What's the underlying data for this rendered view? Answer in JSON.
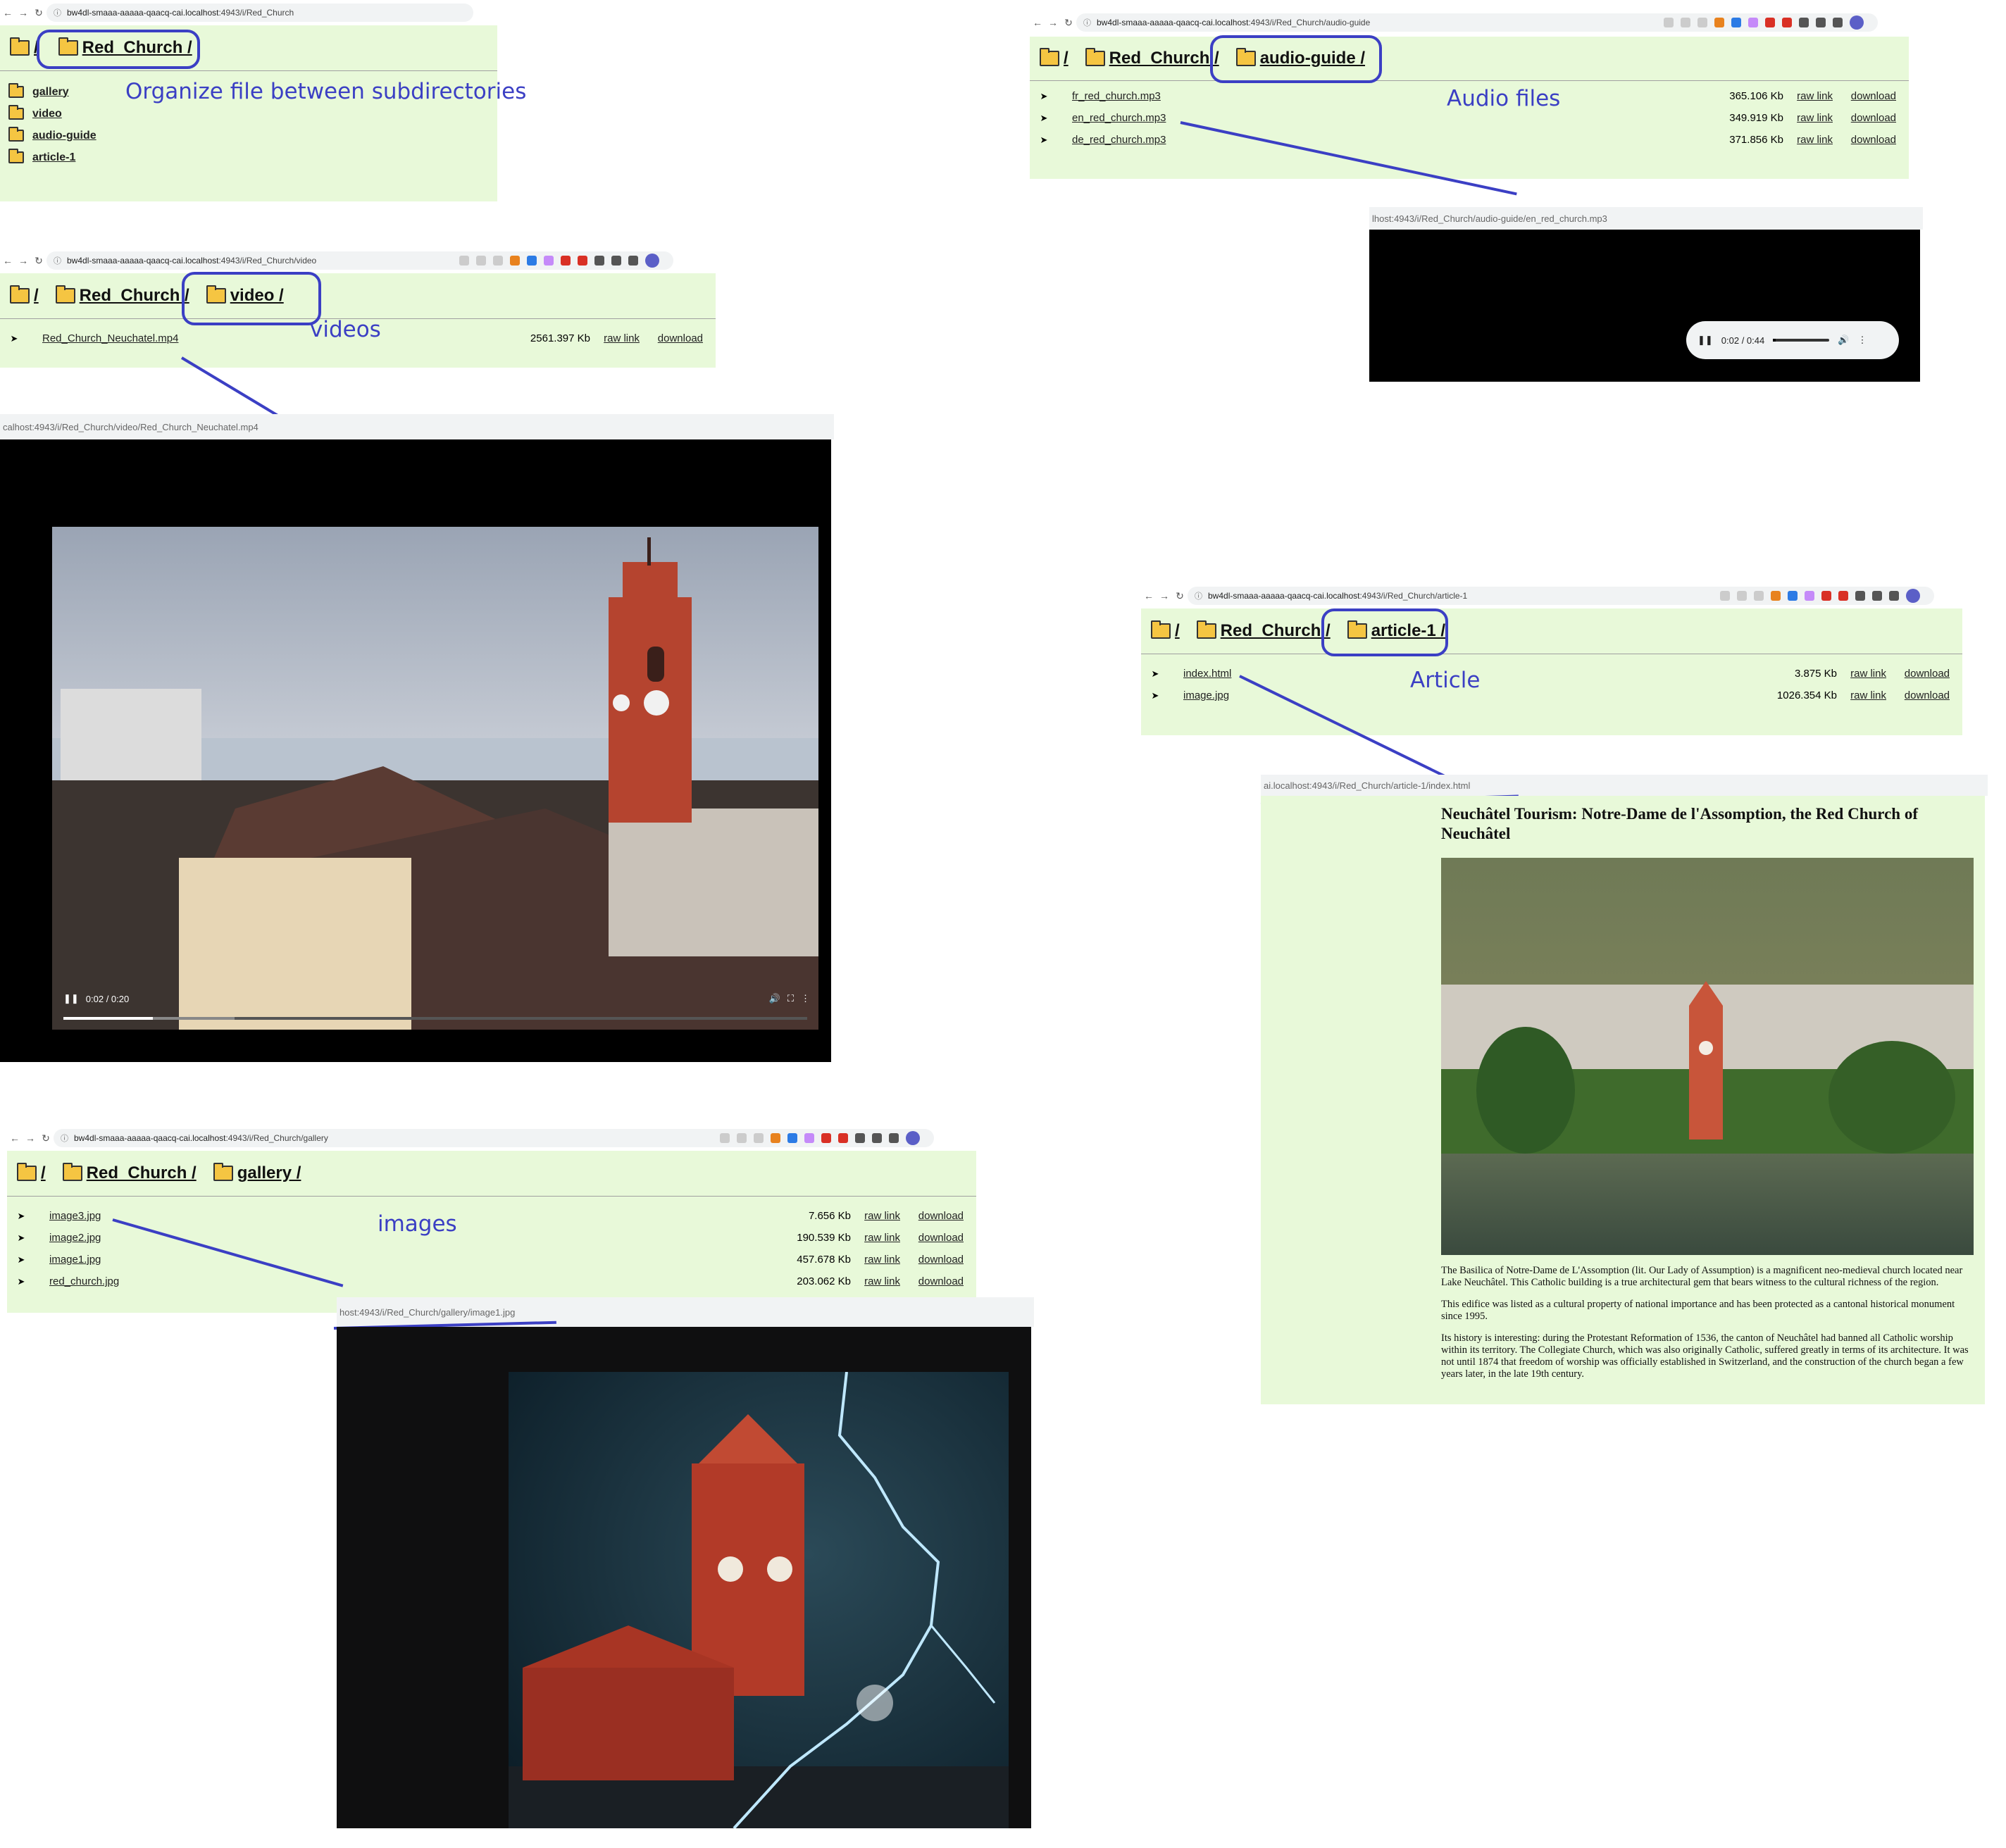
{
  "browser_nav": {
    "back": "←",
    "forward": "→",
    "reload": "↻",
    "lock": "ⓘ"
  },
  "annotation_color": "#3b3fc4",
  "page_bg": "#e8f9d9",
  "root": {
    "url_host": "bw4dl-smaaa-aaaaa-qaacq-cai.localhost",
    "url_path": ":4943/i/Red_Church",
    "crumbs": [
      "/",
      "Red_Church /"
    ],
    "folders": [
      "gallery",
      "video",
      "audio-guide",
      "article-1"
    ],
    "note": "Organize file between subdirectories"
  },
  "audio": {
    "url_host": "bw4dl-smaaa-aaaaa-qaacq-cai.localhost",
    "url_path": ":4943/i/Red_Church/audio-guide",
    "crumbs": [
      "/",
      "Red_Church /",
      "audio-guide /"
    ],
    "files": [
      {
        "name": "fr_red_church.mp3",
        "size": "365.106 Kb",
        "raw": "raw link",
        "download": "download"
      },
      {
        "name": "en_red_church.mp3",
        "size": "349.919 Kb",
        "raw": "raw link",
        "download": "download"
      },
      {
        "name": "de_red_church.mp3",
        "size": "371.856 Kb",
        "raw": "raw link",
        "download": "download"
      }
    ],
    "note": "Audio files",
    "player_url": "lhost:4943/i/Red_Church/audio-guide/en_red_church.mp3",
    "player_time": "0:02 / 0:44",
    "player_progress": 0.05
  },
  "video": {
    "url_host": "bw4dl-smaaa-aaaaa-qaacq-cai.localhost",
    "url_path": ":4943/i/Red_Church/video",
    "crumbs": [
      "/",
      "Red_Church /",
      "video /"
    ],
    "files": [
      {
        "name": "Red_Church_Neuchatel.mp4",
        "size": "2561.397 Kb",
        "raw": "raw link",
        "download": "download"
      }
    ],
    "note": "videos",
    "player_url": "calhost:4943/i/Red_Church/video/Red_Church_Neuchatel.mp4",
    "player_time": "0:02 / 0:20",
    "player_progress": 0.12,
    "buffered": 0.23
  },
  "article": {
    "url_host": "bw4dl-smaaa-aaaaa-qaacq-cai.localhost",
    "url_path": ":4943/i/Red_Church/article-1",
    "crumbs": [
      "/",
      "Red_Church /",
      "article-1 /"
    ],
    "files": [
      {
        "name": "index.html",
        "size": "3.875 Kb",
        "raw": "raw link",
        "download": "download"
      },
      {
        "name": "image.jpg",
        "size": "1026.354 Kb",
        "raw": "raw link",
        "download": "download"
      }
    ],
    "note": "Article ",
    "page_url": "ai.localhost:4943/i/Red_Church/article-1/index.html",
    "title": "Neuchâtel Tourism: Notre-Dame de l'Assomption, the Red Church of Neuchâtel",
    "paragraphs": [
      "The Basilica of Notre-Dame de L'Assomption (lit. Our Lady of Assumption) is a magnificent neo-medieval church located near Lake Neuchâtel. This Catholic building is a true architectural gem that bears witness to the cultural richness of the region.",
      "This edifice was listed as a cultural property of national importance and has been protected as a cantonal historical monument since 1995.",
      "Its history is interesting: during the Protestant Reformation of 1536, the canton of Neuchâtel had banned all Catholic worship within its territory. The Collegiate Church, which was also originally Catholic, suffered greatly in terms of its architecture. It was not until 1874 that freedom of worship was officially established in Switzerland, and the construction of the church began a few years later, in the late 19th century."
    ]
  },
  "gallery": {
    "url_host": "bw4dl-smaaa-aaaaa-qaacq-cai.localhost",
    "url_path": ":4943/i/Red_Church/gallery",
    "crumbs": [
      "/",
      "Red_Church /",
      "gallery /"
    ],
    "files": [
      {
        "name": "image3.jpg",
        "size": "7.656 Kb",
        "raw": "raw link",
        "download": "download"
      },
      {
        "name": "image2.jpg",
        "size": "190.539 Kb",
        "raw": "raw link",
        "download": "download"
      },
      {
        "name": "image1.jpg",
        "size": "457.678 Kb",
        "raw": "raw link",
        "download": "download"
      },
      {
        "name": "red_church.jpg",
        "size": "203.062 Kb",
        "raw": "raw link",
        "download": "download"
      }
    ],
    "note": "images",
    "image_url": "host:4943/i/Red_Church/gallery/image1.jpg"
  }
}
